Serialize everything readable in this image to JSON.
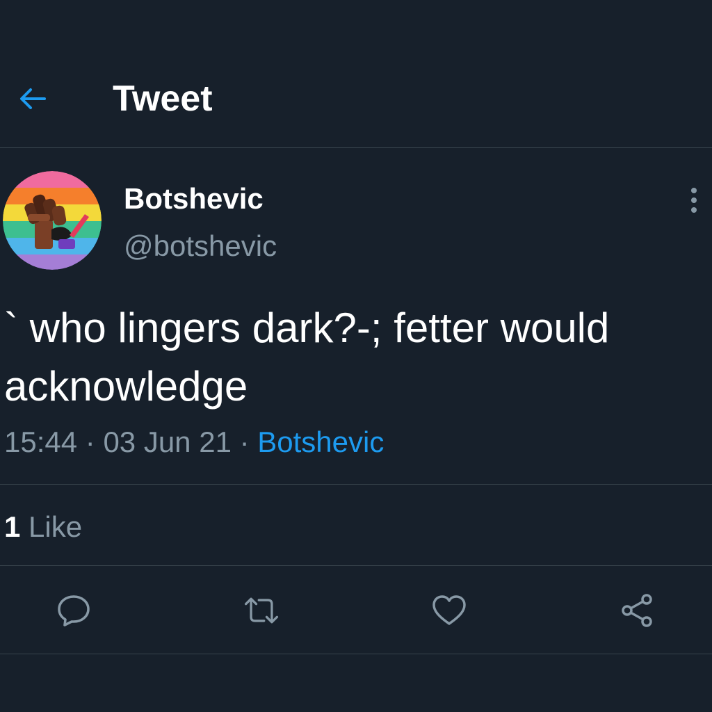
{
  "header": {
    "title": "Tweet",
    "back_icon": "arrow-left-icon"
  },
  "author": {
    "name": "Botshevic",
    "handle": "@botshevic",
    "avatar_icon": "raised-fist-pride-avatar",
    "more_icon": "vertical-ellipsis-icon"
  },
  "tweet": {
    "text": "` who lingers dark?-; fetter would acknowledge",
    "time": "15:44",
    "separator1": " · ",
    "date": "03 Jun 21",
    "separator2": " · ",
    "source": "Botshevic"
  },
  "stats": {
    "likes_count": "1",
    "likes_label": " Like"
  },
  "actions": [
    {
      "name": "reply",
      "icon": "reply-icon"
    },
    {
      "name": "retweet",
      "icon": "retweet-icon"
    },
    {
      "name": "like",
      "icon": "heart-icon"
    },
    {
      "name": "share",
      "icon": "share-icon"
    }
  ],
  "colors": {
    "background": "#17202b",
    "accent": "#1d9bf0",
    "secondary_text": "#8899a6",
    "divider": "#38444d",
    "icon": "#8899a6"
  }
}
